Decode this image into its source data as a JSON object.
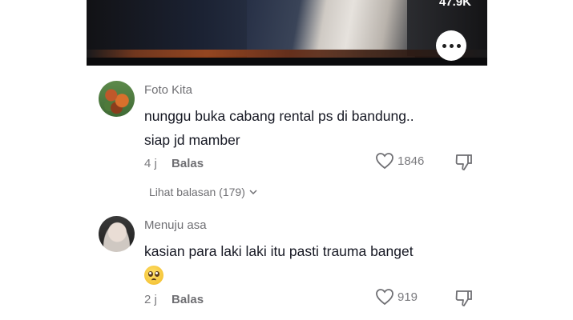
{
  "video": {
    "count": "47.9K",
    "more_icon": "ellipsis-bubble-icon"
  },
  "comments": [
    {
      "username": "Foto Kita",
      "text_line1": "nunggu buka cabang rental ps di bandung..",
      "text_line2": "siap jd mamber",
      "time": "4 j",
      "reply_label": "Balas",
      "likes": "1846",
      "view_replies": "Lihat balasan (179)"
    },
    {
      "username": "Menuju asa",
      "text_line1": "kasian para laki laki itu pasti trauma banget",
      "emoji": "pleading-face-icon",
      "time": "2 j",
      "reply_label": "Balas",
      "likes": "919"
    }
  ],
  "colors": {
    "text": "#161823",
    "muted": "#7a7a7e",
    "video_bg": "#0d0d10"
  }
}
